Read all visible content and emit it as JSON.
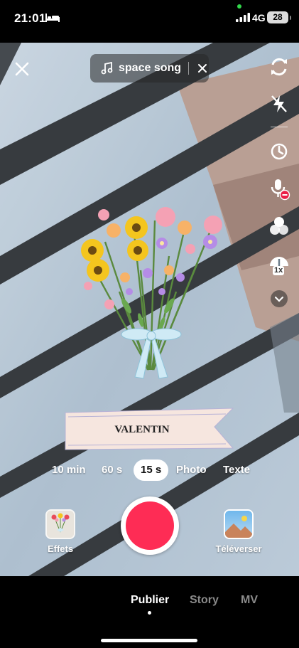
{
  "status_bar": {
    "time": "21:01",
    "network": "4G",
    "battery": "28"
  },
  "top": {
    "sound_title": "space song"
  },
  "sticker": {
    "banner_text": "VALENTIN"
  },
  "durations": [
    {
      "label": "10 min",
      "active": false
    },
    {
      "label": "60 s",
      "active": false
    },
    {
      "label": "15 s",
      "active": true
    },
    {
      "label": "Photo",
      "active": false
    },
    {
      "label": "Texte",
      "active": false
    }
  ],
  "capture": {
    "effects_label": "Effets",
    "upload_label": "Téléverser"
  },
  "right_tools": [
    "flip-camera-icon",
    "flash-off-icon",
    "timer-icon",
    "microphone-muted-icon",
    "beauty-filter-icon",
    "speed-icon",
    "more-chevron-icon"
  ],
  "speed_badge": "1x",
  "bottom_tabs": [
    {
      "label": "Publier",
      "active": true
    },
    {
      "label": "Story",
      "active": false
    },
    {
      "label": "MV",
      "active": false
    }
  ],
  "colors": {
    "record": "#fe2c55",
    "accent_active_tab": "#ffffff",
    "inactive_tab": "#8a8a8a"
  }
}
